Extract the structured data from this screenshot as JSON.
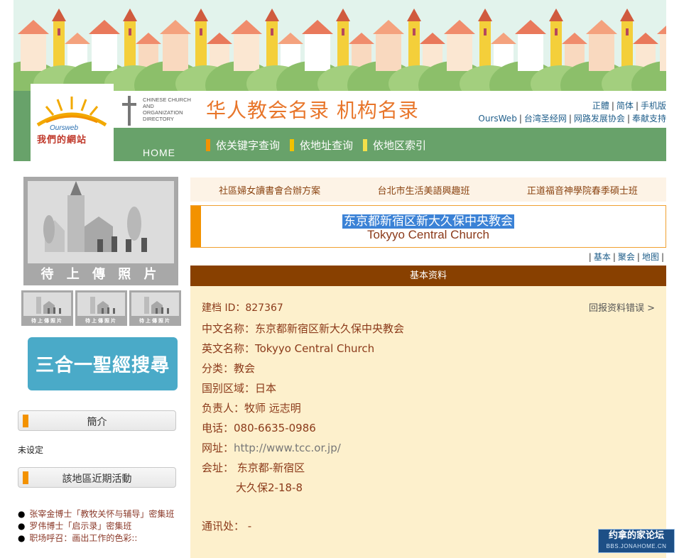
{
  "logo": {
    "sub": "Oursweb",
    "title": "我們的網站"
  },
  "home_label": "HOME",
  "directory_en": "CHINESE CHURCH AND ORGANIZATION DIRECTORY",
  "site_title": "华人教会名录  机构名录",
  "lang_links": [
    "正體",
    "简体",
    "手机版"
  ],
  "top_links": [
    "OursWeb",
    "台湾圣经网",
    "网路发展协会",
    "奉献支持"
  ],
  "search_nav": [
    {
      "label": "依关键字查询",
      "color": "#f39200"
    },
    {
      "label": "依地址查询",
      "color": "#f2c200"
    },
    {
      "label": "依地区索引",
      "color": "#f4e04a"
    }
  ],
  "photo_caption": "待 上 傳 照 片",
  "thumb_caption": "待上傳照片",
  "bible_search": "三合一聖經搜尋",
  "intro": {
    "title": "簡介",
    "text": "未设定"
  },
  "events": {
    "title": "該地區近期活動",
    "items": [
      "张宰金博士「教牧关怀与辅导」密集班",
      "罗伟博士「启示录」密集班",
      "职场呼召：画出工作的色彩::"
    ]
  },
  "quick_links": [
    "社區婦女讀書會合辦方案",
    "台北市生活美語興趣班",
    "正道福音神學院春季碩士班"
  ],
  "church": {
    "name_zh": "东京都新宿区新大久保中央教会",
    "name_en": "Tokyyo Central Church"
  },
  "sub_tabs": [
    "基本",
    "聚会",
    "地图"
  ],
  "section_title": "基本资料",
  "record_id": "建档 ID：827367",
  "report_error": "回报资料错误 >",
  "fields": {
    "zh": "中文名称：东京都新宿区新大久保中央教会",
    "en": "英文名称：Tokyyo Central Church",
    "type": "分类：教会",
    "country": "国别区域：日本",
    "leader": "负责人：牧师 远志明",
    "phone": "电话：080-6635-0986",
    "url_label": "网址：",
    "url": "http://www.tcc.or.jp/",
    "addr1": "会址：  东京都-新宿区",
    "addr2": "大久保2-18-8",
    "contact": "通讯处：  -"
  },
  "watermark": {
    "line1": "约拿的家论坛",
    "line2": "BBS.JONAHOME.CN"
  },
  "colors": {
    "green": "#68a26a",
    "orange": "#f39200",
    "brown": "#884000",
    "cream": "#fdf0cc"
  }
}
